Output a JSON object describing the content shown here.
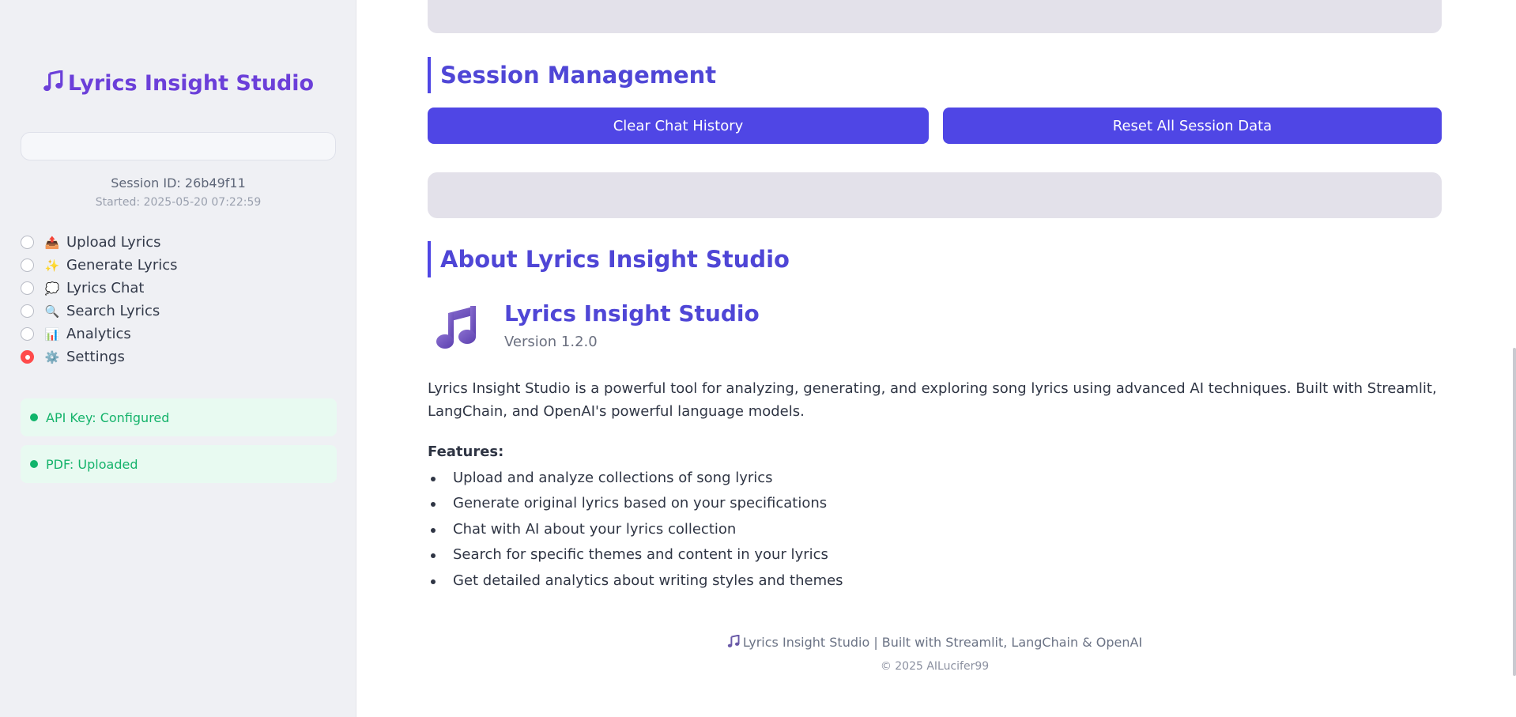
{
  "sidebar": {
    "brand": "Lyrics Insight Studio",
    "session_id": "Session ID: 26b49f11",
    "session_started": "Started: 2025-05-20 07:22:59",
    "nav": [
      {
        "icon": "📤",
        "label": "Upload Lyrics",
        "selected": false
      },
      {
        "icon": "✨",
        "label": "Generate Lyrics",
        "selected": false
      },
      {
        "icon": "💭",
        "label": "Lyrics Chat",
        "selected": false
      },
      {
        "icon": "🔍",
        "label": "Search Lyrics",
        "selected": false
      },
      {
        "icon": "📊",
        "label": "Analytics",
        "selected": false
      },
      {
        "icon": "⚙️",
        "label": "Settings",
        "selected": true
      }
    ],
    "status": [
      {
        "label": "API Key: Configured"
      },
      {
        "label": "PDF: Uploaded"
      }
    ]
  },
  "main": {
    "session_section": {
      "title": "Session Management",
      "clear_button": "Clear Chat History",
      "reset_button": "Reset All Session Data"
    },
    "about_section": {
      "title": "About Lyrics Insight Studio",
      "app_name": "Lyrics Insight Studio",
      "version": "Version 1.2.0",
      "description": "Lyrics Insight Studio is a powerful tool for analyzing, generating, and exploring song lyrics using advanced AI techniques. Built with Streamlit, LangChain, and OpenAI's powerful language models.",
      "features_label": "Features:",
      "features": [
        "Upload and analyze collections of song lyrics",
        "Generate original lyrics based on your specifications",
        "Chat with AI about your lyrics collection",
        "Search for specific themes and content in your lyrics",
        "Get detailed analytics about writing styles and themes"
      ]
    },
    "footer": {
      "line": "Lyrics Insight Studio | Built with Streamlit, LangChain & OpenAI",
      "copyright": "© 2025 AILucifer99"
    }
  },
  "colors": {
    "accent": "#4f46e5",
    "brand": "#6b3fd9",
    "success": "#10b46b",
    "radio_selected": "#ff4b4b"
  },
  "icons": {
    "brand": "music-note-icon",
    "about_logo": "music-note-icon",
    "footer": "music-note-icon"
  }
}
